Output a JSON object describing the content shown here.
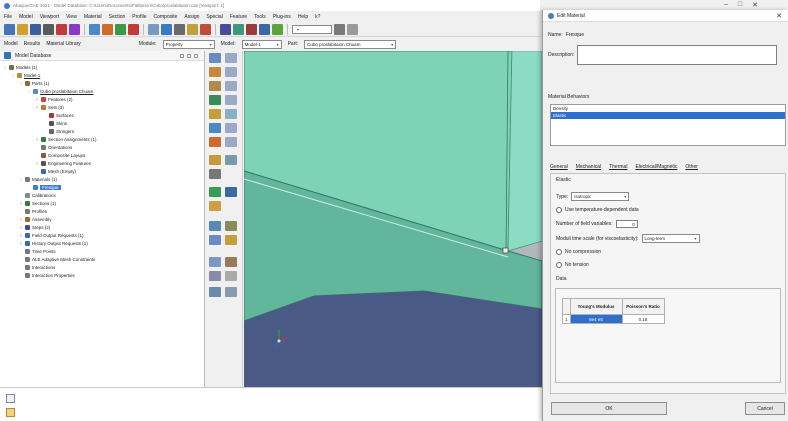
{
  "window": {
    "title": "Abaqus/CAE 2021 - Model Database: C:\\Users\\Documents\\Faltbeton\\Cubo\\proslabitaion.cae [Viewport: 1]",
    "controls": [
      "–",
      "□",
      "✕"
    ]
  },
  "menubar": [
    "File",
    "Model",
    "Viewport",
    "View",
    "Material",
    "Section",
    "Profile",
    "Composite",
    "Assign",
    "Special",
    "Feature",
    "Tools",
    "Plug-ins",
    "Help",
    "k?"
  ],
  "context": {
    "tabs": [
      "Model",
      "Results",
      "Material Library"
    ],
    "module_label": "Module:",
    "module_value": "Property",
    "model_label": "Model:",
    "model_value": "Model-1",
    "part_label": "Part:",
    "part_value": "Cubo proslabitaion Chuam"
  },
  "tree": {
    "header": "Model Database",
    "items": [
      {
        "label": "Models (1)",
        "indent": 0,
        "exp": "−",
        "icon": "#7a6a4a"
      },
      {
        "label": "Model-1",
        "indent": 1,
        "exp": "−",
        "icon": "#b88a3a",
        "u": true
      },
      {
        "label": "Parts (1)",
        "indent": 2,
        "exp": "−",
        "icon": "#8a6a3a"
      },
      {
        "label": "Cubo proslabitaion Chuam",
        "indent": 3,
        "exp": "−",
        "icon": "#5a8ac4",
        "u": true
      },
      {
        "label": "Features (2)",
        "indent": 4,
        "exp": "+",
        "icon": "#c44"
      },
      {
        "label": "Sets (3)",
        "indent": 4,
        "exp": "+",
        "icon": "#b08030"
      },
      {
        "label": "Surfaces",
        "indent": 5,
        "exp": "",
        "icon": "#a03a3a"
      },
      {
        "label": "Skins",
        "indent": 5,
        "exp": "",
        "icon": "#555"
      },
      {
        "label": "Stringers",
        "indent": 5,
        "exp": "",
        "icon": "#666"
      },
      {
        "label": "Section Assignments (1)",
        "indent": 4,
        "exp": "+",
        "icon": "#3a7a3a"
      },
      {
        "label": "Orientations",
        "indent": 4,
        "exp": "",
        "icon": "#777"
      },
      {
        "label": "Composite Layups",
        "indent": 4,
        "exp": "",
        "icon": "#8a5a3a"
      },
      {
        "label": "Engineering Features",
        "indent": 4,
        "exp": "+",
        "icon": "#555"
      },
      {
        "label": "Mesh (Empty)",
        "indent": 4,
        "exp": "",
        "icon": "#3a6aa4"
      },
      {
        "label": "Materials (1)",
        "indent": 2,
        "exp": "−",
        "icon": "#777"
      },
      {
        "label": "Fresque",
        "indent": 3,
        "exp": "",
        "icon": "#3c7bd6",
        "sel": true
      },
      {
        "label": "Calibrations",
        "indent": 2,
        "exp": "",
        "icon": "#888"
      },
      {
        "label": "Sections (1)",
        "indent": 2,
        "exp": "+",
        "icon": "#3a7a3a"
      },
      {
        "label": "Profiles",
        "indent": 2,
        "exp": "",
        "icon": "#777"
      },
      {
        "label": "Assembly",
        "indent": 2,
        "exp": "+",
        "icon": "#a06a2a"
      },
      {
        "label": "Steps (2)",
        "indent": 2,
        "exp": "+",
        "icon": "#4a4a9a"
      },
      {
        "label": "Field Output Requests (1)",
        "indent": 2,
        "exp": "+",
        "icon": "#3a6aa4"
      },
      {
        "label": "History Output Requests (1)",
        "indent": 2,
        "exp": "+",
        "icon": "#3a6aa4"
      },
      {
        "label": "Time Points",
        "indent": 2,
        "exp": "",
        "icon": "#777"
      },
      {
        "label": "ALE Adaptive Mesh Constraints",
        "indent": 2,
        "exp": "",
        "icon": "#777"
      },
      {
        "label": "Interactions",
        "indent": 2,
        "exp": "",
        "icon": "#777"
      },
      {
        "label": "Interaction Properties",
        "indent": 2,
        "exp": "",
        "icon": "#777"
      }
    ]
  },
  "dialog": {
    "title": "Edit Material",
    "close": "✕",
    "name_label": "Name:",
    "name_value": "Fresque",
    "description_label": "Description:",
    "behaviors_label": "Material Behaviors",
    "behaviors": [
      "Density",
      "Elastic"
    ],
    "tabs": [
      "General",
      "Mechanical",
      "Thermal",
      "Electrical/Magnetic",
      "Other"
    ],
    "section_title": "Elastic",
    "type_label": "Type:",
    "type_value": "Isotropic",
    "use_temp": "Use temperature-dependent data",
    "field_vars_label": "Number of field variables:",
    "field_vars_value": "0",
    "moduli_label": "Moduli time scale (for viscoelasticity):",
    "moduli_value": "Long-term",
    "no_compression": "No compression",
    "no_tension": "No tension",
    "data_label": "Data",
    "table": {
      "headers": [
        "Young's Modulus",
        "Poisson's Ratio"
      ],
      "rows": [
        [
          "1",
          "6e4 e5",
          "0.18"
        ]
      ]
    },
    "ok_label": "OK",
    "cancel_label": "Cancel"
  }
}
